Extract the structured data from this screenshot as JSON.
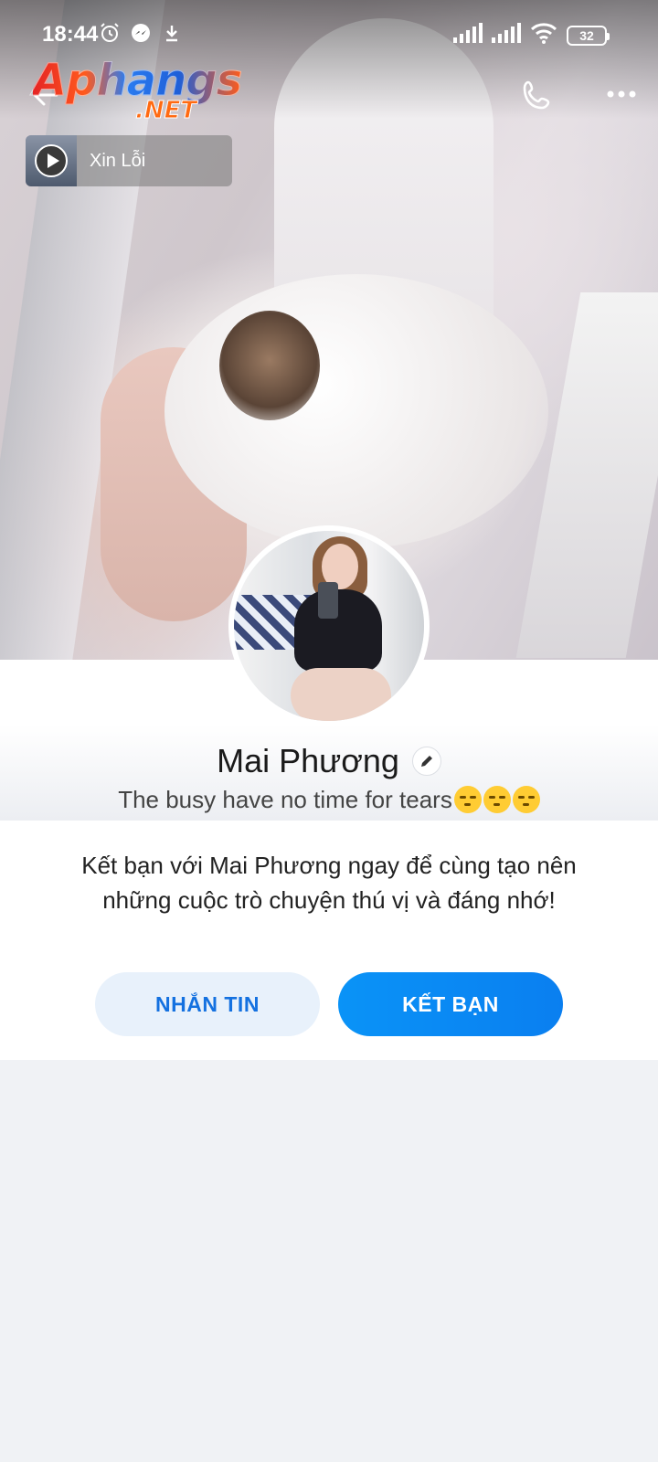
{
  "statusbar": {
    "time": "18:44",
    "battery": "32"
  },
  "logo": {
    "main": "Aphangs",
    "sub": ".NET"
  },
  "music": {
    "title": "Xin Lỗi"
  },
  "profile": {
    "name": "Mai Phương",
    "status": "The busy have no time for tears",
    "status_emoji": [
      "😏",
      "😏",
      "😏"
    ]
  },
  "invite": {
    "text": "Kết bạn với Mai Phương ngay để cùng tạo nên những cuộc trò chuyện thú vị và đáng nhớ!"
  },
  "buttons": {
    "message": "NHẮN TIN",
    "add_friend": "KẾT BẠN"
  },
  "colors": {
    "primary": "#0a8cf5",
    "secondary_bg": "#e8f1fb",
    "page_bg": "#f0f2f5"
  }
}
